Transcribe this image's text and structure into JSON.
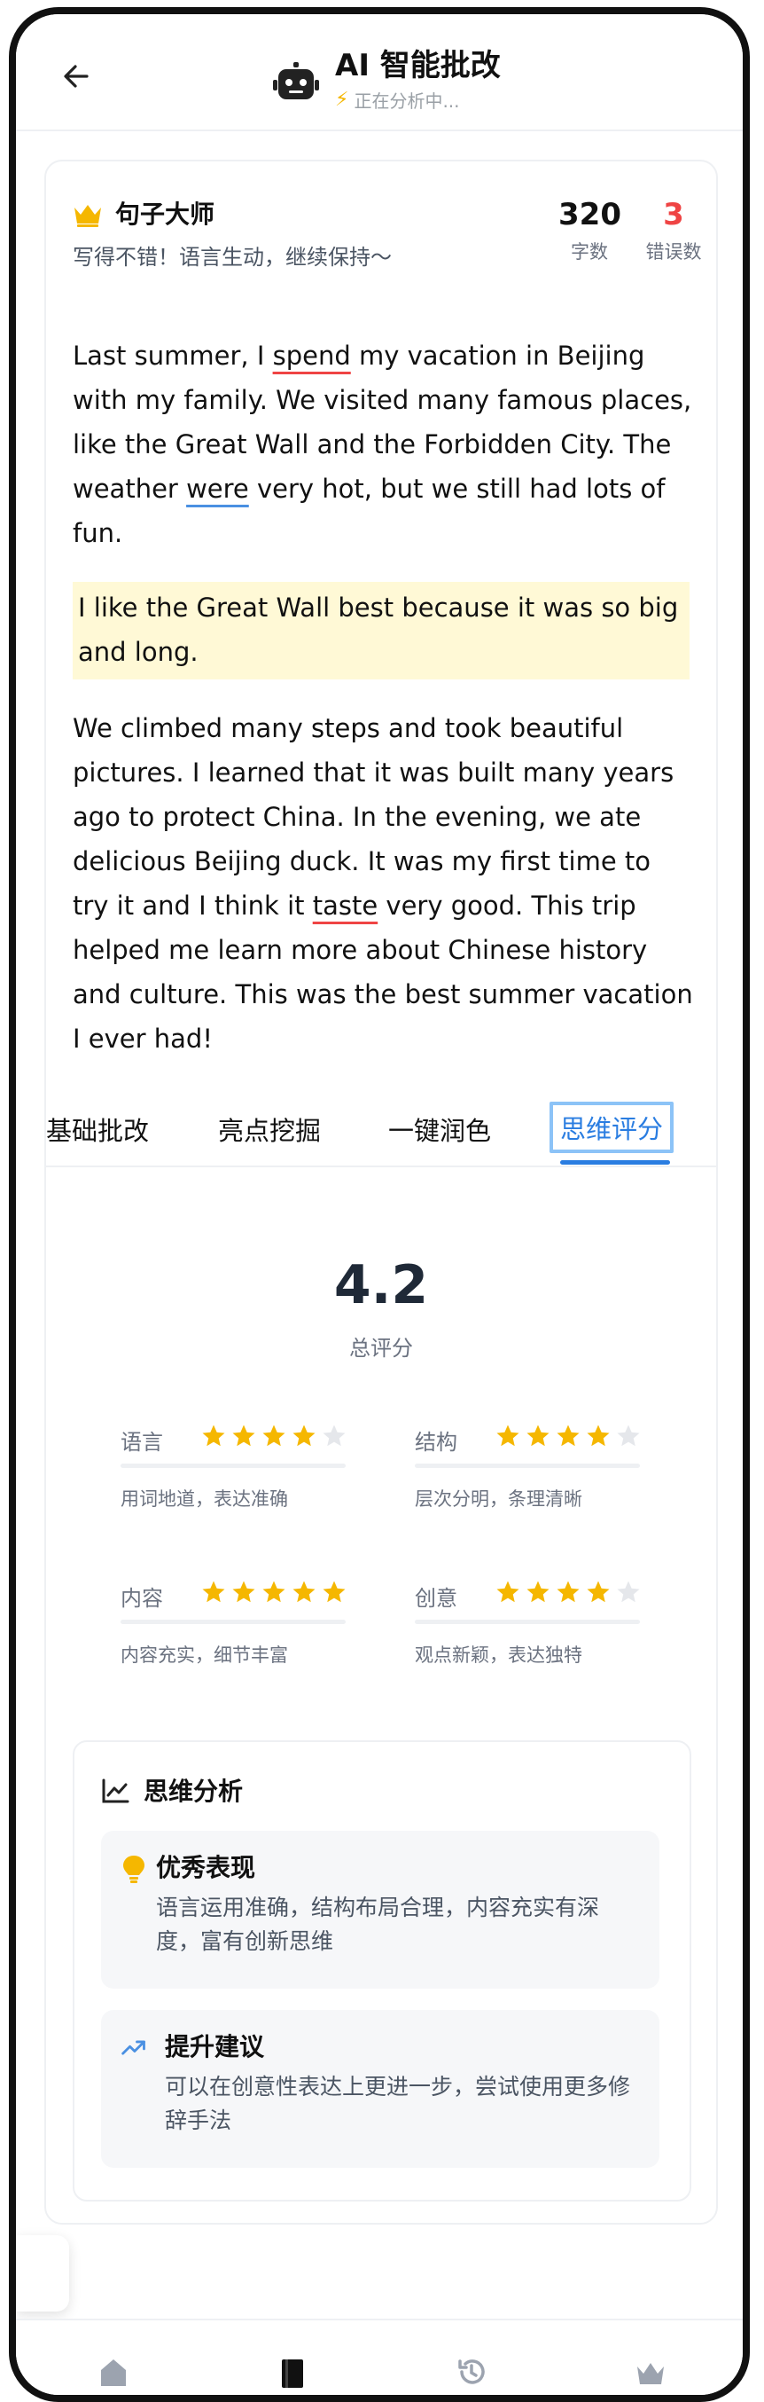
{
  "header": {
    "title": "AI 智能批改",
    "subtitle": "正在分析中...",
    "icons": [
      "back-arrow-icon",
      "robot-icon",
      "bolt-icon"
    ]
  },
  "badge": {
    "title": "句子大师",
    "praise": "写得不错！语言生动，继续保持～",
    "icon": "crown-icon"
  },
  "stats": {
    "word_count": "320",
    "word_count_label": "字数",
    "error_count": "3",
    "error_count_label": "错误数"
  },
  "essay": {
    "p1_a": "Last summer, I ",
    "p1_err1": "spend",
    "p1_b": " my vacation in Beijing with my family. We visited many famous places, like the Great Wall and the Forbidden City. The weather ",
    "p1_err2": "were",
    "p1_c": " very hot, but we still had lots of fun.",
    "highlight": "I like the Great Wall best because it was so big and long.",
    "p3_a": "We climbed many steps and took beautiful pictures. I learned that it was built many years ago to protect China. In the evening, we ate delicious Beijing duck. It was my first time to try it and I think it ",
    "p3_err": "taste",
    "p3_b": " very good. This trip helped me learn more about Chinese history and culture. This was the best summer vacation I ever had!"
  },
  "tabs": [
    {
      "label": "基础批改"
    },
    {
      "label": "亮点挖掘"
    },
    {
      "label": "一键润色"
    },
    {
      "label": "思维评分",
      "active": true
    }
  ],
  "score": {
    "value": "4.2",
    "label": "总评分"
  },
  "metrics": [
    {
      "name": "语言",
      "stars": 4,
      "desc": "用词地道，表达准确"
    },
    {
      "name": "结构",
      "stars": 4,
      "desc": "层次分明，条理清晰"
    },
    {
      "name": "内容",
      "stars": 5,
      "desc": "内容充实，细节丰富"
    },
    {
      "name": "创意",
      "stars": 4,
      "desc": "观点新颖，表达独特"
    }
  ],
  "analysis": {
    "title": "思维分析",
    "strength_title": "优秀表现",
    "strength_text": "语言运用准确，结构布局合理，内容充实有深度，富有创新思维",
    "suggest_title": "提升建议",
    "suggest_text": "可以在创意性表达上更进一步，尝试使用更多修辞手法"
  },
  "tabbar": {
    "icons": [
      "home-icon",
      "book-icon",
      "history-icon",
      "crown-icon"
    ]
  },
  "colors": {
    "accent": "#2a7de1",
    "error": "#ef4444",
    "star": "#f5b700",
    "highlight_bg": "#fff9d6"
  }
}
